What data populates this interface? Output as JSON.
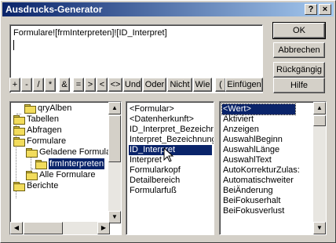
{
  "window": {
    "title": "Ausdrucks-Generator"
  },
  "titlebar": {
    "help": "?",
    "close": "×"
  },
  "expression": {
    "value": "Formulare![frmInterpreten]![ID_Interpret]"
  },
  "buttons": {
    "ok": "OK",
    "cancel": "Abbrechen",
    "undo": "Rückgängig",
    "help": "Hilfe",
    "paste": "Einfügen"
  },
  "operators": [
    "+",
    "-",
    "/",
    "*",
    "&",
    "=",
    ">",
    "<",
    "<>",
    "Und",
    "Oder",
    "Nicht",
    "Wie",
    "(",
    ")"
  ],
  "tree": [
    {
      "label": "qryAlben",
      "icon": "folder-icon"
    },
    {
      "label": "Tabellen",
      "icon": "folder-icon",
      "expander": "+"
    },
    {
      "label": "Abfragen",
      "icon": "folder-icon",
      "expander": "+"
    },
    {
      "label": "Formulare",
      "icon": "folder-icon",
      "expander": "-"
    },
    {
      "label": "Geladene Formula",
      "icon": "folder-icon",
      "expander": "-"
    },
    {
      "label": "frmInterpreten",
      "icon": "folder-open-icon"
    },
    {
      "label": "Alle Formulare",
      "icon": "folder-icon",
      "expander": "+"
    },
    {
      "label": "Berichte",
      "icon": "folder-icon",
      "expander": "+"
    }
  ],
  "fields": [
    "<Formular>",
    "<Datenherkunft>",
    "ID_Interpret_Bezeichnu",
    "Interpret_Bezeichnung",
    "ID_Interpret",
    "Interpret",
    "Formularkopf",
    "Detailbereich",
    "Formularfuß"
  ],
  "properties": [
    "<Wert>",
    "Aktiviert",
    "Anzeigen",
    "AuswahlBeginn",
    "AuswahlLänge",
    "AuswahlText",
    "AutoKorrekturZulas:",
    "Automatischweiter",
    "BeiÄnderung",
    "BeiFokuserhalt",
    "BeiFokusverlust"
  ]
}
